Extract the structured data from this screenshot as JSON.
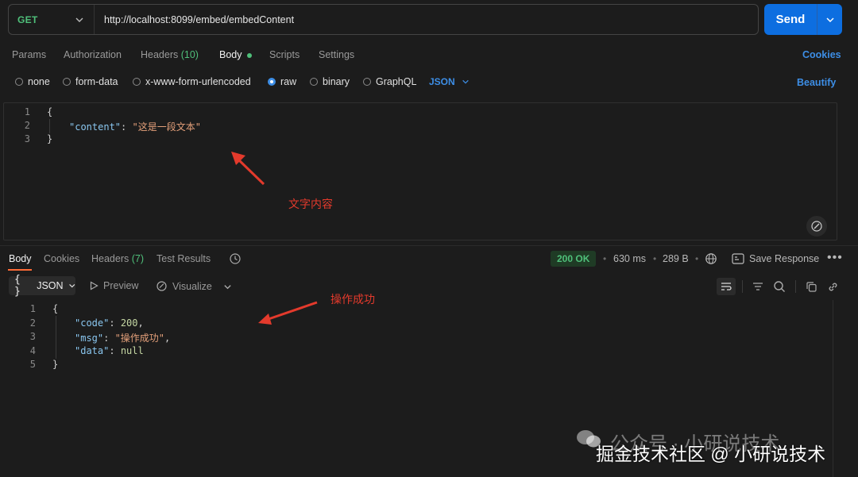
{
  "request": {
    "method": "GET",
    "url": "http://localhost:8099/embed/embedContent",
    "send_label": "Send"
  },
  "request_tabs": {
    "params": "Params",
    "authorization": "Authorization",
    "headers": "Headers",
    "headers_count": "(10)",
    "body": "Body",
    "scripts": "Scripts",
    "settings": "Settings",
    "cookies": "Cookies"
  },
  "body_types": {
    "none": "none",
    "form_data": "form-data",
    "urlencoded": "x-www-form-urlencoded",
    "raw": "raw",
    "binary": "binary",
    "graphql": "GraphQL",
    "selected": "raw",
    "language": "JSON",
    "beautify": "Beautify"
  },
  "request_body": {
    "line_numbers": [
      "1",
      "2",
      "3"
    ],
    "open": "{",
    "key": "\"content\"",
    "colon": ": ",
    "value": "\"这是一段文本\"",
    "close": "}"
  },
  "annotations": {
    "request_note": "文字内容",
    "response_note": "操作成功",
    "color": "#e33a2c"
  },
  "response_tabs": {
    "body": "Body",
    "cookies": "Cookies",
    "headers": "Headers",
    "headers_count": "(7)",
    "test_results": "Test Results"
  },
  "response_meta": {
    "status": "200 OK",
    "time": "630 ms",
    "size": "289 B",
    "save": "Save Response"
  },
  "response_toolbar": {
    "format": "JSON",
    "preview": "Preview",
    "visualize": "Visualize"
  },
  "response_body": {
    "line_numbers": [
      "1",
      "2",
      "3",
      "4",
      "5"
    ],
    "open": "{",
    "code_key": "\"code\"",
    "code_value": "200",
    "msg_key": "\"msg\"",
    "msg_value": "\"操作成功\"",
    "data_key": "\"data\"",
    "data_value": "null",
    "close": "}"
  },
  "watermark": {
    "line1": "公众号 · 小研说技术",
    "line2": "掘金技术社区 @ 小研说技术"
  },
  "colors": {
    "accent": "#0d6ee0",
    "method_green": "#4fc07a",
    "link_blue": "#3d8ee6",
    "tab_underline": "#ff6c37",
    "background": "#1c1c1c"
  }
}
